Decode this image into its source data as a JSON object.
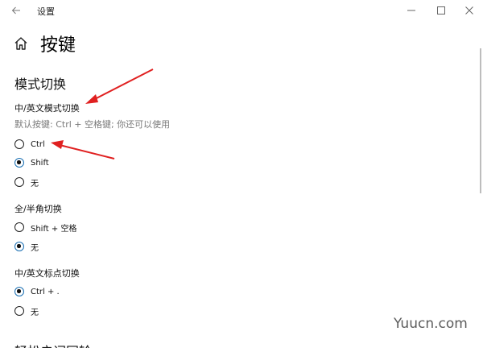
{
  "window": {
    "title": "设置",
    "back_icon": "back-arrow-icon",
    "minimize_icon": "minimize-icon",
    "maximize_icon": "maximize-icon",
    "close_icon": "close-icon"
  },
  "header": {
    "home_icon": "home-icon",
    "title": "按键"
  },
  "section": {
    "title": "模式切换"
  },
  "groups": [
    {
      "title": "中/英文模式切换",
      "hint": "默认按键: Ctrl + 空格键; 你还可以使用",
      "options": [
        {
          "label": "Ctrl",
          "checked": false
        },
        {
          "label": "Shift",
          "checked": true
        },
        {
          "label": "无",
          "checked": false
        }
      ]
    },
    {
      "title": "全/半角切换",
      "options": [
        {
          "label": "Shift + 空格",
          "checked": false
        },
        {
          "label": "无",
          "checked": true
        }
      ]
    },
    {
      "title": "中/英文标点切换",
      "options": [
        {
          "label": "Ctrl + .",
          "checked": true
        },
        {
          "label": "无",
          "checked": false
        }
      ]
    }
  ],
  "next_section": {
    "title": "轻松启词同轮"
  },
  "annotation_color": "#e02020",
  "watermark": "Yuucn.com"
}
